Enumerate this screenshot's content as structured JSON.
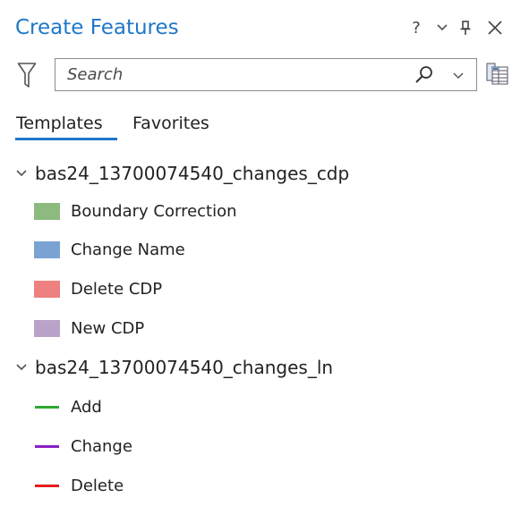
{
  "pane": {
    "title": "Create Features",
    "help_glyph": "?"
  },
  "search": {
    "placeholder": "Search",
    "value": ""
  },
  "tabs": [
    {
      "label": "Templates",
      "active": true
    },
    {
      "label": "Favorites",
      "active": false
    }
  ],
  "layers": [
    {
      "name": "bas24_13700074540_changes_cdp",
      "expanded": true,
      "templates": [
        {
          "label": "Boundary Correction",
          "symbol": "polygon",
          "color": "#8dba7e"
        },
        {
          "label": "Change Name",
          "symbol": "polygon",
          "color": "#7aa3d4"
        },
        {
          "label": "Delete CDP",
          "symbol": "polygon",
          "color": "#ee8080"
        },
        {
          "label": "New CDP",
          "symbol": "polygon",
          "color": "#b9a3c8"
        }
      ]
    },
    {
      "name": "bas24_13700074540_changes_ln",
      "expanded": true,
      "templates": [
        {
          "label": "Add",
          "symbol": "line",
          "color": "#2fa82f"
        },
        {
          "label": "Change",
          "symbol": "line",
          "color": "#8a1fc4"
        },
        {
          "label": "Delete",
          "symbol": "line",
          "color": "#e31d1d"
        }
      ]
    }
  ],
  "colors": {
    "accent": "#1f78c8",
    "text": "#222222",
    "search_border": "#8c8c8c"
  },
  "icons": {
    "filter": "filter-icon",
    "search": "search-icon",
    "dropdown": "chevron-down-icon",
    "table": "table-view-icon",
    "help": "help-icon",
    "options": "chevron-down-icon",
    "pin": "pin-icon",
    "close": "close-icon"
  }
}
